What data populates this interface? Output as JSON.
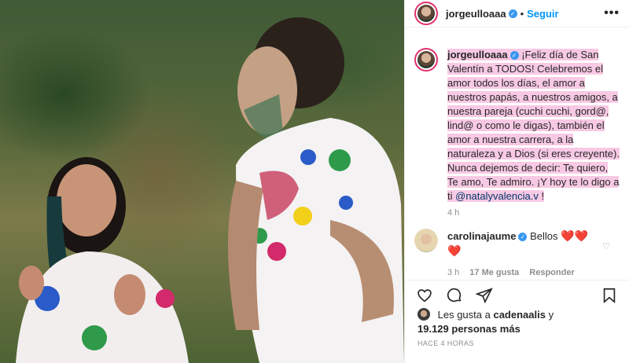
{
  "post": {
    "username": "jorgeulloaaa",
    "dot": "•",
    "follow_label": "Seguir",
    "more": "•••",
    "caption_start": "¡Feliz día de San Valentín a TODOS! Celebremos el amor todos los días, el amor a nuestros papás, a nuestros amigos, a nuestra pareja (cuchi cuchi, gord@, lind@ o como le digas), también el amor a nuestra carrera, a la naturaleza y a Dios (si eres creyente). Nunca dejemos de decir: Te quiero, Te amo, Te admiro. ¡Y hoy te lo digo a ti ",
    "caption_mention": "@natalyvalencia.v",
    "caption_end": " !",
    "caption_time": "4 h"
  },
  "comment": {
    "username": "carolinajaume",
    "text": "Bellos",
    "hearts": "❤️❤️",
    "heart2": "❤️",
    "time": "3 h",
    "likes": "17 Me gusta",
    "reply": "Responder"
  },
  "likes": {
    "line1": "Les gusta a",
    "liker": "cadenaalis",
    "and": "y",
    "count": "19.129 personas más"
  },
  "ago": "HACE 4 HORAS",
  "colors": {
    "accent": "#0095f6",
    "verified": "#3897f0",
    "highlight": "#f8c9e4",
    "heart": "#ed4956"
  }
}
